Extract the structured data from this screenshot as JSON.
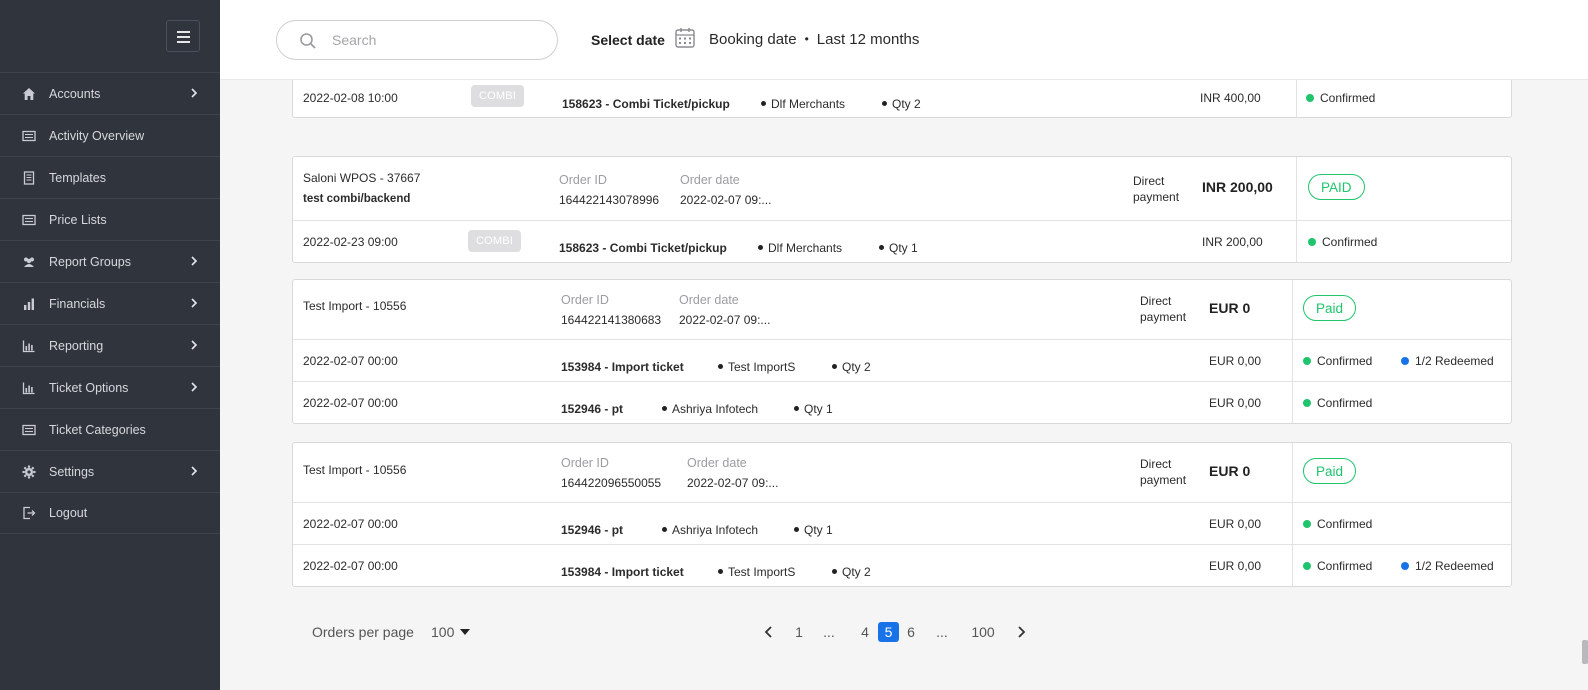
{
  "sidebar": {
    "items": [
      {
        "label": "Accounts",
        "icon": "home-icon",
        "has_submenu": true
      },
      {
        "label": "Activity Overview",
        "icon": "list-icon",
        "has_submenu": false
      },
      {
        "label": "Templates",
        "icon": "document-icon",
        "has_submenu": false
      },
      {
        "label": "Price Lists",
        "icon": "list-icon",
        "has_submenu": false
      },
      {
        "label": "Report Groups",
        "icon": "users-icon",
        "has_submenu": true
      },
      {
        "label": "Financials",
        "icon": "bar-chart-icon",
        "has_submenu": true
      },
      {
        "label": "Reporting",
        "icon": "chart-icon",
        "has_submenu": true
      },
      {
        "label": "Ticket Options",
        "icon": "chart-icon",
        "has_submenu": true
      },
      {
        "label": "Ticket Categories",
        "icon": "list-icon",
        "has_submenu": false
      },
      {
        "label": "Settings",
        "icon": "gear-icon",
        "has_submenu": true
      },
      {
        "label": "Logout",
        "icon": "logout-icon",
        "has_submenu": false
      }
    ]
  },
  "header": {
    "search_placeholder": "Search",
    "select_date_label": "Select date",
    "date_type": "Booking date",
    "date_separator": "•",
    "date_range": "Last 12 months"
  },
  "labels": {
    "order_id": "Order ID",
    "order_date": "Order date",
    "direct_payment_line1": "Direct",
    "direct_payment_line2": "payment",
    "combi_tag": "COMBI"
  },
  "orders": [
    {
      "lines": [
        {
          "date": "2022-02-08 10:00",
          "combi": true,
          "product": "158623 - Combi Ticket/pickup",
          "merchant": "Dlf Merchants",
          "qty": "Qty 2",
          "amount": "INR 400,00",
          "status": "Confirmed"
        }
      ]
    },
    {
      "customer": "Saloni WPOS - 37667",
      "note": "test combi/backend",
      "order_id": "164422143078996",
      "order_date": "2022-02-07 09:...",
      "total": "INR 200,00",
      "payment_status": "PAID",
      "lines": [
        {
          "date": "2022-02-23 09:00",
          "combi": true,
          "product": "158623 - Combi Ticket/pickup",
          "merchant": "Dlf Merchants",
          "qty": "Qty 1",
          "amount": "INR 200,00",
          "status": "Confirmed"
        }
      ]
    },
    {
      "customer": "Test Import - 10556",
      "order_id": "164422141380683",
      "order_date": "2022-02-07 09:...",
      "total": "EUR 0",
      "payment_status": "Paid",
      "lines": [
        {
          "date": "2022-02-07 00:00",
          "product": "153984 - Import ticket",
          "merchant": "Test ImportS",
          "qty": "Qty 2",
          "amount": "EUR 0,00",
          "status": "Confirmed",
          "redeemed": "1/2 Redeemed"
        },
        {
          "date": "2022-02-07 00:00",
          "product": "152946 - pt",
          "merchant": "Ashriya Infotech",
          "qty": "Qty 1",
          "amount": "EUR 0,00",
          "status": "Confirmed"
        }
      ]
    },
    {
      "customer": "Test Import - 10556",
      "order_id": "164422096550055",
      "order_date": "2022-02-07 09:...",
      "total": "EUR 0",
      "payment_status": "Paid",
      "lines": [
        {
          "date": "2022-02-07 00:00",
          "product": "152946 - pt",
          "merchant": "Ashriya Infotech",
          "qty": "Qty 1",
          "amount": "EUR 0,00",
          "status": "Confirmed"
        },
        {
          "date": "2022-02-07 00:00",
          "product": "153984 - Import ticket",
          "merchant": "Test ImportS",
          "qty": "Qty 2",
          "amount": "EUR 0,00",
          "status": "Confirmed",
          "redeemed": "1/2 Redeemed"
        }
      ]
    }
  ],
  "pagination": {
    "per_page_label": "Orders per page",
    "per_page_value": "100",
    "pages": [
      "1",
      "...",
      "4",
      "5",
      "6",
      "...",
      "100"
    ],
    "current_page": "5"
  },
  "colors": {
    "sidebar_bg": "#2f343d",
    "accent_green": "#1fc46d",
    "accent_blue": "#1873e8"
  }
}
